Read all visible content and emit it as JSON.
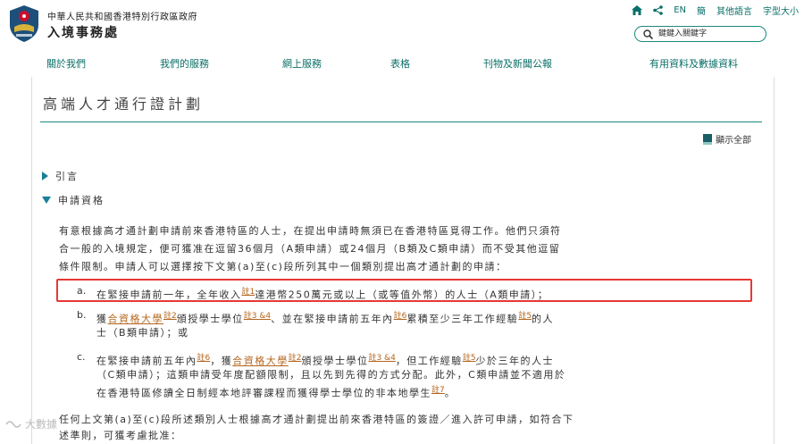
{
  "header": {
    "gov_name": "中華人民共和國香港特別行政區政府",
    "dept_name": "入境事務處",
    "toplinks": {
      "lang_en": "EN",
      "lang_sc": "簡",
      "other_lang": "其他語言",
      "font_size": "字型大小"
    },
    "search_placeholder": "鍵鍵入關鍵字"
  },
  "nav": [
    "關於我們",
    "我們的服務",
    "網上服務",
    "表格",
    "刊物及新聞公報",
    "有用資料及數據資料"
  ],
  "main": {
    "title": "高端人才通行證計劃",
    "show_all": "顯示全部",
    "sections": {
      "intro": "引言",
      "eligibility": "申請資格"
    },
    "intro_para": [
      "有意根據高才通計劃申請前來香港特區的人士，在提出申請時無須已在香港特區覓得工作。他們只須符",
      "合一般的入境規定，便可獲准在逗留36個月（A類申請）或24個月（B類及C類申請）而不受其他逗留",
      "條件限制。申請人可以選擇按下文第(a)至(c)段所列其中一個類別提出高才通計劃的申請："
    ],
    "item_a": {
      "marker": "a.",
      "t1": "在緊接申請前一年，全年收入",
      "n1": "註1",
      "t2": "達港幣250萬元或以上（或等值外幣）的人士（A類申請）；"
    },
    "item_b": {
      "marker": "b.",
      "t1": "獲",
      "link1": "合資格大學",
      "n1": "註2",
      "t2": "頒授學士學位",
      "n2": "註3 &4",
      "t3": "、並在緊接申請前五年內",
      "n3": "註6",
      "t4": "累積至少三年工作經驗",
      "n4": "註5",
      "t5": "的人",
      "line2": "士（B類申請）；或"
    },
    "item_c": {
      "marker": "c.",
      "t1": "在緊接申請前五年內",
      "n1": "註6",
      "t2": "，獲",
      "link1": "合資格大學",
      "n2": "註2",
      "t3": "頒授學士學位",
      "n3": "註3 &4",
      "t4": "，但工作經驗",
      "n4": "註5",
      "t5": "少於三年的人士",
      "line2": "（C類申請）；這類申請受年度配額限制，且以先到先得的方式分配。此外，C類申請並不適用於",
      "line3a": "在香港特區修讀全日制經本地評審課程而獲得學士學位的非本地學生",
      "n5": "註7",
      "line3b": "。"
    },
    "closing_para": [
      "任何上文第(a)至(c)段所述類別人士根據高才通計劃提出前來香港特區的簽證／進入許可申請，如符合下",
      "述準則，可獲考慮批准："
    ]
  },
  "watermark": "大數據"
}
